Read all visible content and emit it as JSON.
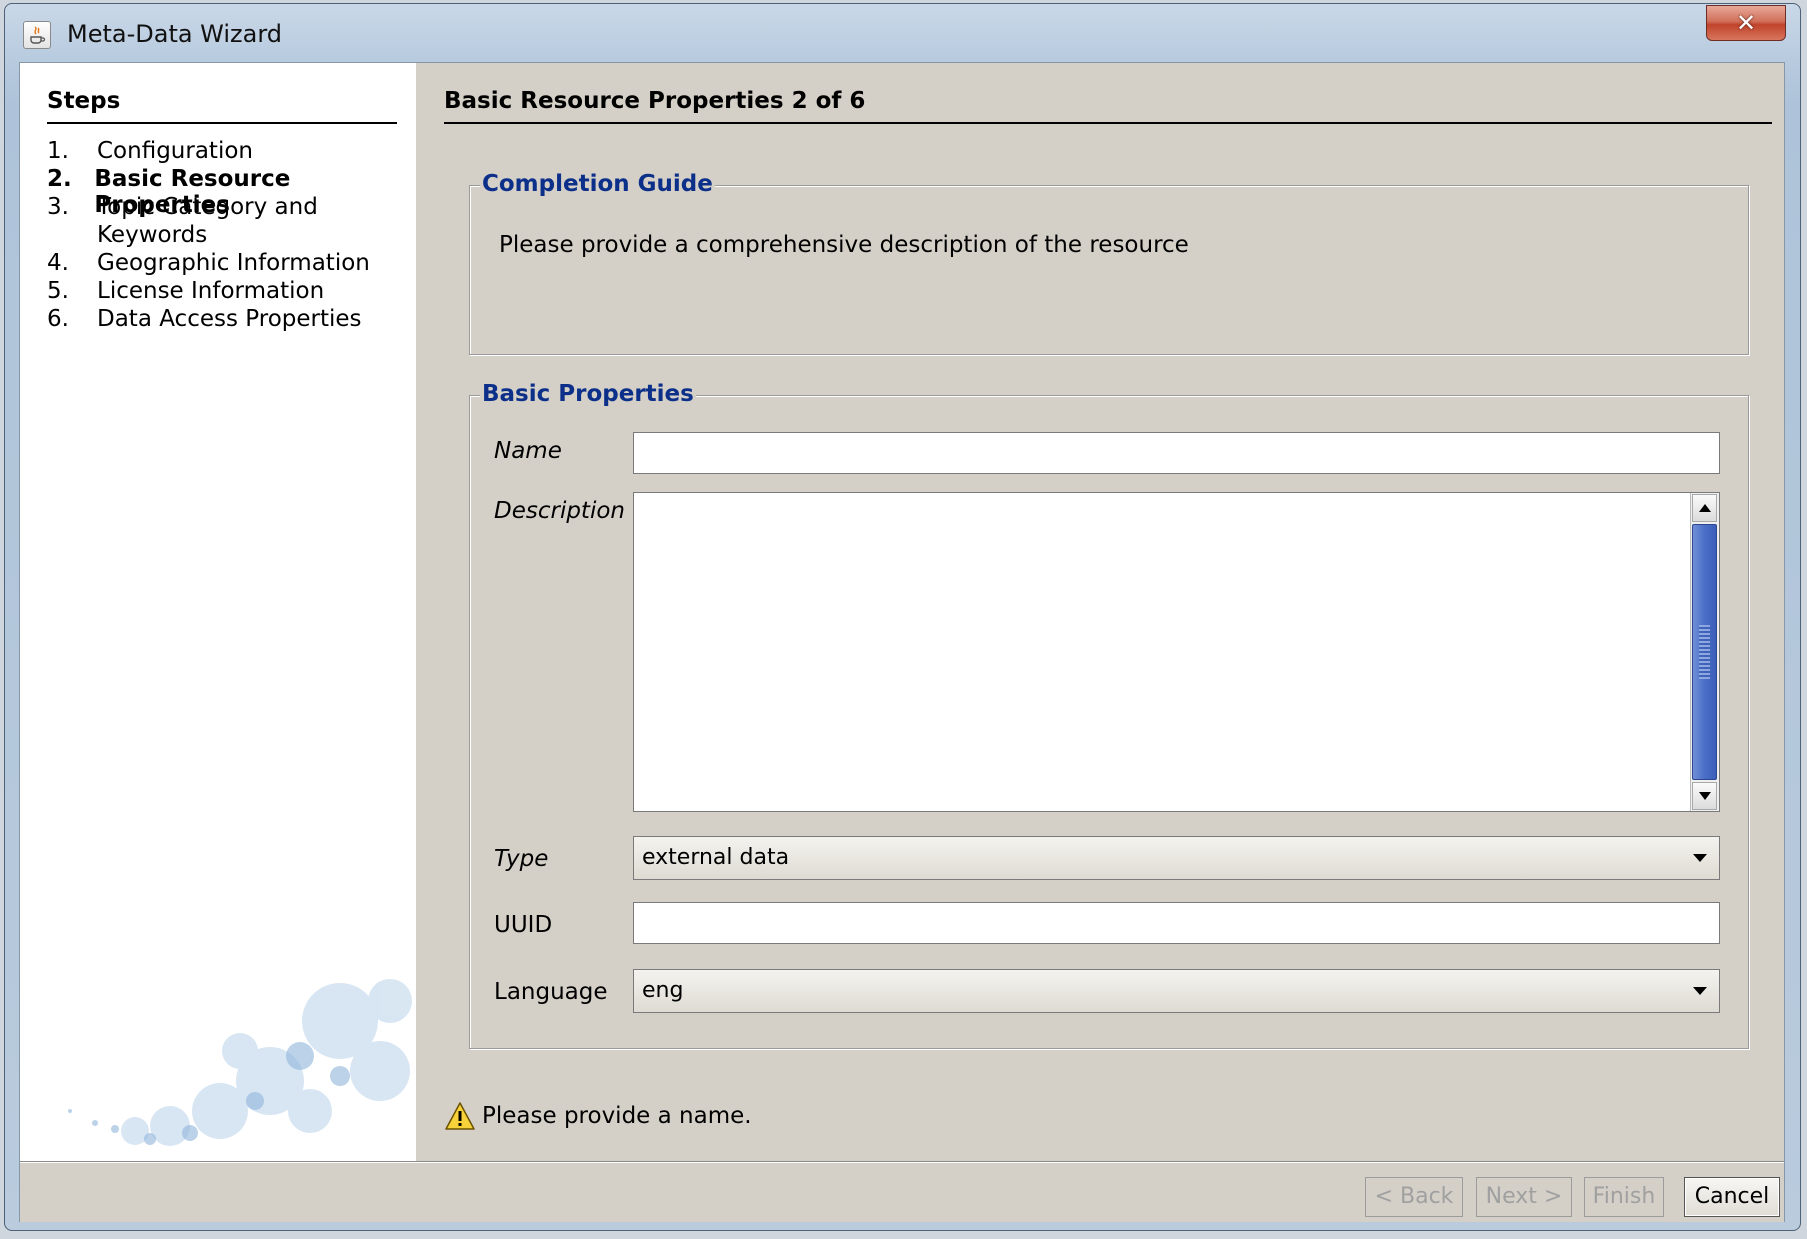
{
  "window": {
    "title": "Meta-Data Wizard",
    "close_glyph": "✕",
    "app_icon": "java-cup-icon"
  },
  "steps": {
    "title": "Steps",
    "items": [
      {
        "num": "1.",
        "label": "Configuration"
      },
      {
        "num": "2.",
        "label": "Basic Resource Properties"
      },
      {
        "num": "3.",
        "label": "Topic Category and"
      },
      {
        "num": "",
        "label": "Keywords"
      },
      {
        "num": "4.",
        "label": "Geographic Information"
      },
      {
        "num": "5.",
        "label": "License Information"
      },
      {
        "num": "6.",
        "label": "Data Access Properties"
      }
    ]
  },
  "content": {
    "title": "Basic Resource Properties 2 of 6",
    "guide": {
      "legend": "Completion Guide",
      "text": "Please provide a comprehensive description of the resource"
    },
    "basic": {
      "legend": "Basic Properties",
      "name_label": "Name",
      "name_value": "",
      "description_label": "Description",
      "description_value": "",
      "type_label": "Type",
      "type_value": "external data",
      "uuid_label": "UUID",
      "uuid_value": "",
      "language_label": "Language",
      "language_value": "eng"
    },
    "warning": "Please provide a name."
  },
  "buttons": {
    "back": "< Back",
    "next": "Next >",
    "finish": "Finish",
    "cancel": "Cancel"
  },
  "colors": {
    "legend": "#0c2f8a",
    "panel": "#d4d0c8",
    "scroll_thumb": "#4a6fc8",
    "close": "#c0432b"
  }
}
